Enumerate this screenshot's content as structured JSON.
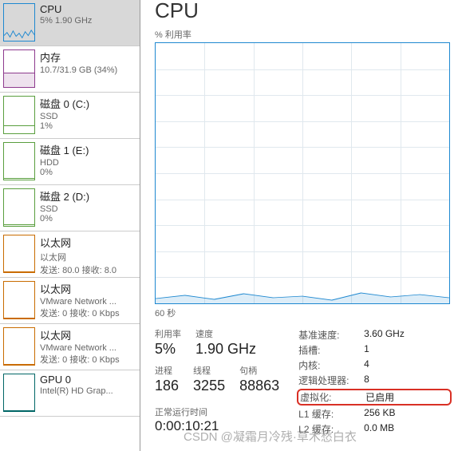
{
  "sidebar": {
    "items": [
      {
        "title": "CPU",
        "sub": "5% 1.90 GHz",
        "sub2": ""
      },
      {
        "title": "内存",
        "sub": "10.7/31.9 GB (34%)",
        "sub2": ""
      },
      {
        "title": "磁盘 0 (C:)",
        "sub": "SSD",
        "sub2": "1%"
      },
      {
        "title": "磁盘 1 (E:)",
        "sub": "HDD",
        "sub2": "0%"
      },
      {
        "title": "磁盘 2 (D:)",
        "sub": "SSD",
        "sub2": "0%"
      },
      {
        "title": "以太网",
        "sub": "以太网",
        "sub2": "发送: 80.0 接收: 8.0"
      },
      {
        "title": "以太网",
        "sub": "VMware Network ...",
        "sub2": "发送: 0 接收: 0 Kbps"
      },
      {
        "title": "以太网",
        "sub": "VMware Network ...",
        "sub2": "发送: 0 接收: 0 Kbps"
      },
      {
        "title": "GPU 0",
        "sub": "Intel(R) HD Grap...",
        "sub2": ""
      }
    ]
  },
  "main": {
    "title": "CPU",
    "chart_label": "% 利用率",
    "chart_axis": "60 秒",
    "stats_left": {
      "row1": [
        {
          "lbl": "利用率",
          "val": "5%"
        },
        {
          "lbl": "速度",
          "val": "1.90 GHz"
        }
      ],
      "row2": [
        {
          "lbl": "进程",
          "val": "186"
        },
        {
          "lbl": "线程",
          "val": "3255"
        },
        {
          "lbl": "句柄",
          "val": "88863"
        }
      ],
      "uptime_lbl": "正常运行时间",
      "uptime_val": "0:00:10:21"
    },
    "stats_right": [
      {
        "k": "基准速度:",
        "v": "3.60 GHz"
      },
      {
        "k": "插槽:",
        "v": "1"
      },
      {
        "k": "内核:",
        "v": "4"
      },
      {
        "k": "逻辑处理器:",
        "v": "8"
      },
      {
        "k": "虚拟化:",
        "v": "已启用",
        "highlight": true
      },
      {
        "k": "L1 缓存:",
        "v": "256 KB"
      },
      {
        "k": "L2 缓存:",
        "v": "0.0 MB"
      }
    ]
  },
  "chart_data": {
    "type": "line",
    "title": "% 利用率",
    "xlabel": "60 秒",
    "ylabel": "% 利用率",
    "ylim": [
      0,
      100
    ],
    "series": [
      {
        "name": "CPU",
        "values": [
          5,
          6,
          5,
          4,
          6,
          5,
          5,
          7,
          5,
          4
        ]
      }
    ]
  },
  "watermark": "CSDN @凝霜月冷残·草木愁白衣"
}
